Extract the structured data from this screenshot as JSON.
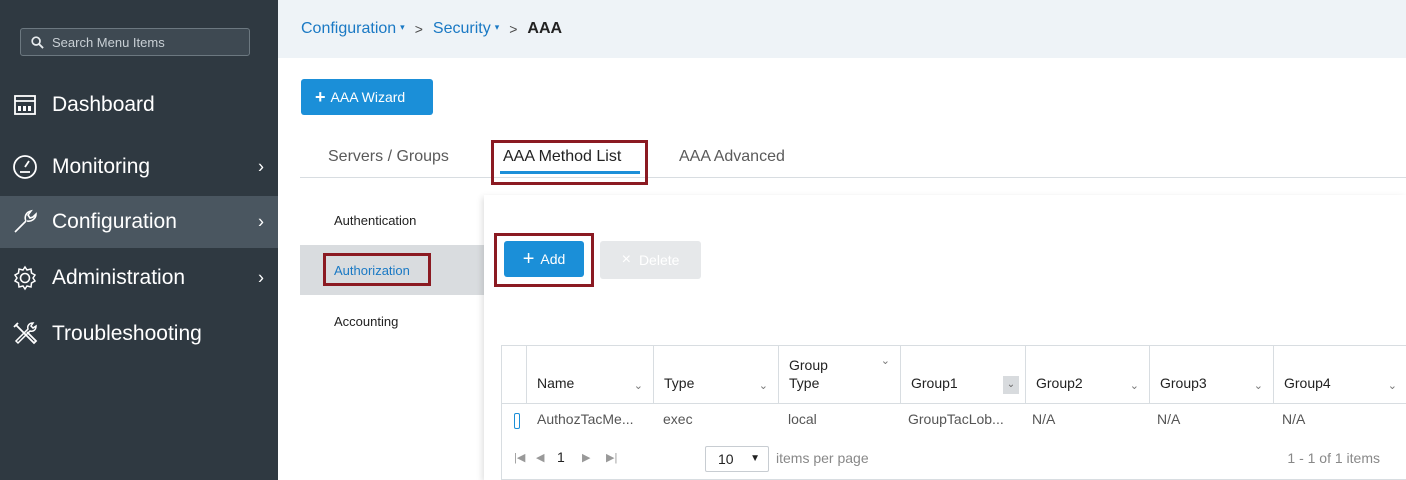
{
  "sidebar": {
    "search_placeholder": "Search Menu Items",
    "items": [
      {
        "label": "Dashboard",
        "icon": "dashboard-icon",
        "chevron": ""
      },
      {
        "label": "Monitoring",
        "icon": "monitoring-icon",
        "chevron": "›"
      },
      {
        "label": "Configuration",
        "icon": "configuration-icon",
        "chevron": "›"
      },
      {
        "label": "Administration",
        "icon": "administration-icon",
        "chevron": "›"
      },
      {
        "label": "Troubleshooting",
        "icon": "troubleshooting-icon",
        "chevron": ""
      }
    ]
  },
  "breadcrumb": {
    "items": [
      "Configuration",
      "Security"
    ],
    "current": "AAA",
    "separator": ">",
    "caret": "▾"
  },
  "wizard_button": {
    "icon": "+",
    "label": "AAA Wizard"
  },
  "tabs": [
    "Servers / Groups",
    "AAA Method List",
    "AAA Advanced"
  ],
  "submenu": [
    "Authentication",
    "Authorization",
    "Accounting"
  ],
  "actions": {
    "add_icon": "+",
    "add_label": "Add",
    "delete_icon": "×",
    "delete_label": "Delete"
  },
  "grid": {
    "columns": [
      {
        "line1": "Name",
        "line2": ""
      },
      {
        "line1": "Type",
        "line2": ""
      },
      {
        "line1": "Group",
        "line2": "Type"
      },
      {
        "line1": "Group1",
        "line2": ""
      },
      {
        "line1": "Group2",
        "line2": ""
      },
      {
        "line1": "Group3",
        "line2": ""
      },
      {
        "line1": "Group4",
        "line2": ""
      }
    ],
    "rows": [
      [
        "AuthozTacMe...",
        "exec",
        "local",
        "GroupTacLob...",
        "N/A",
        "N/A",
        "N/A"
      ]
    ],
    "pager": {
      "page": "1",
      "per_page": "10",
      "per_page_label": "items per page",
      "count_label": "1 - 1 of 1 items"
    }
  },
  "colors": {
    "sidebar_bg": "#2f3941",
    "accent": "#1b8fd8",
    "highlight_box": "#8b1a22"
  }
}
